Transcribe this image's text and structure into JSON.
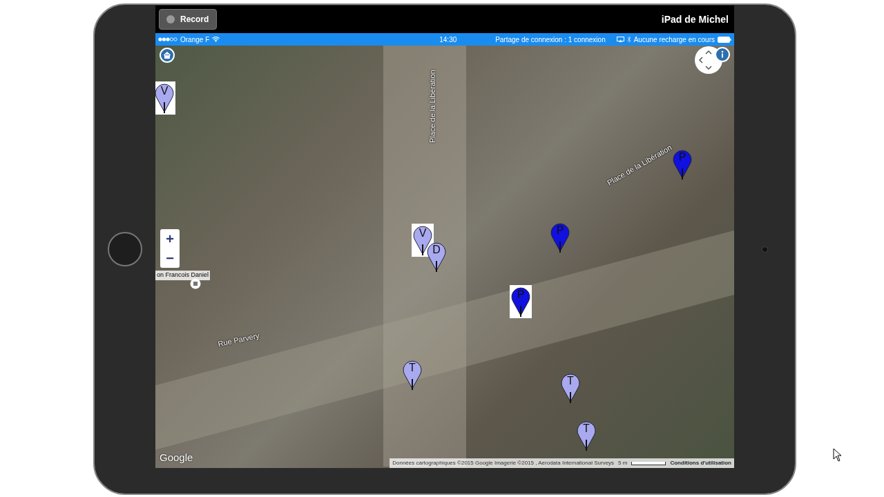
{
  "recorder": {
    "record_label": "Record",
    "recording": false,
    "device_name": "iPad de Michel"
  },
  "status_bar": {
    "carrier": "Orange F",
    "time": "14:30",
    "hotspot": "Partage de connexion : 1 connexion",
    "charging": "Aucune recharge en cours"
  },
  "map": {
    "street_labels": [
      "Place de la Libération",
      "Place de la Libération",
      "Rue Parvery",
      "on Francois Daniel"
    ],
    "zoom_in": "+",
    "zoom_out": "−",
    "markers": [
      {
        "letter": "V",
        "color": "#a9a9f0",
        "highlighted": true
      },
      {
        "letter": "V",
        "color": "#a9a9f0",
        "highlighted": true
      },
      {
        "letter": "D",
        "color": "#a9a9f0",
        "highlighted": false
      },
      {
        "letter": "P",
        "color": "#1010e0",
        "highlighted": false
      },
      {
        "letter": "P",
        "color": "#1010e0",
        "highlighted": false
      },
      {
        "letter": "P",
        "color": "#1010e0",
        "highlighted": true
      },
      {
        "letter": "T",
        "color": "#a9a9f0",
        "highlighted": false
      },
      {
        "letter": "T",
        "color": "#a9a9f0",
        "highlighted": false
      },
      {
        "letter": "T",
        "color": "#a9a9f0",
        "highlighted": false
      }
    ],
    "logo": "Google",
    "attribution": "Données cartographiques ©2015 Google Imagerie ©2015 , Aerodata International Surveys",
    "scale": "5 m",
    "terms": "Conditions d'utilisation"
  }
}
